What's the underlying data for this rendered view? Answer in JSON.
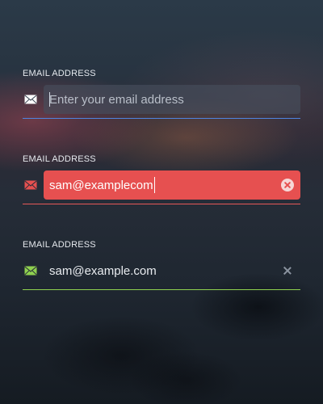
{
  "fields": [
    {
      "label": "EMAIL ADDRESS",
      "value": "",
      "placeholder": "Enter your email address",
      "state": "focused",
      "icon": "envelope-icon",
      "icon_color": "#ffffff",
      "underline_color": "#4f84e0"
    },
    {
      "label": "EMAIL ADDRESS",
      "value": "sam@examplecom",
      "placeholder": "",
      "state": "error",
      "icon": "envelope-icon",
      "icon_color": "#e65050",
      "underline_color": "#e65858",
      "action_icon": "clear-circle-icon"
    },
    {
      "label": "EMAIL ADDRESS",
      "value": "sam@example.com",
      "placeholder": "",
      "state": "valid",
      "icon": "envelope-icon",
      "icon_color": "#8fd14f",
      "underline_color": "#8fd14f",
      "action_icon": "close-icon"
    }
  ]
}
